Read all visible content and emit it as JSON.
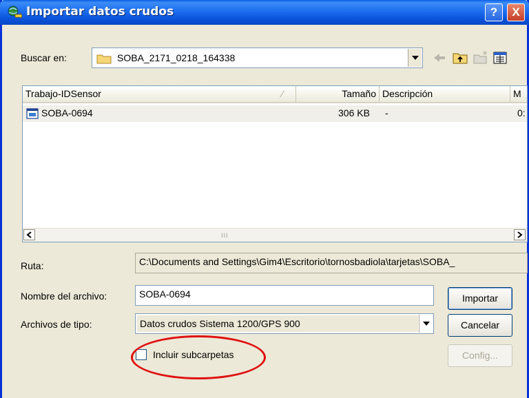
{
  "window": {
    "title": "Importar datos crudos",
    "help_label": "?",
    "close_label": "X"
  },
  "lookin": {
    "label": "Buscar en:",
    "value": "SOBA_2171_0218_164338"
  },
  "columns": [
    "Trabajo-IDSensor",
    "Tamaño",
    "Descripción",
    "M"
  ],
  "rows": [
    {
      "name": "SOBA-0694",
      "size": "306 KB",
      "description": "-",
      "extra": "0:"
    }
  ],
  "path": {
    "label": "Ruta:",
    "value": "C:\\Documents and Settings\\Gim4\\Escritorio\\tornosbadiola\\tarjetas\\SOBA_"
  },
  "filename": {
    "label": "Nombre del archivo:",
    "value": "SOBA-0694"
  },
  "filetype": {
    "label": "Archivos de tipo:",
    "value": "Datos crudos Sistema 1200/GPS 900"
  },
  "buttons": {
    "import": "Importar",
    "cancel": "Cancelar",
    "config": "Config..."
  },
  "checkbox": {
    "label": "Incluir subcarpetas",
    "checked": false
  },
  "colors": {
    "titlebar": "#0a5de6",
    "annotation": "#e01010"
  }
}
